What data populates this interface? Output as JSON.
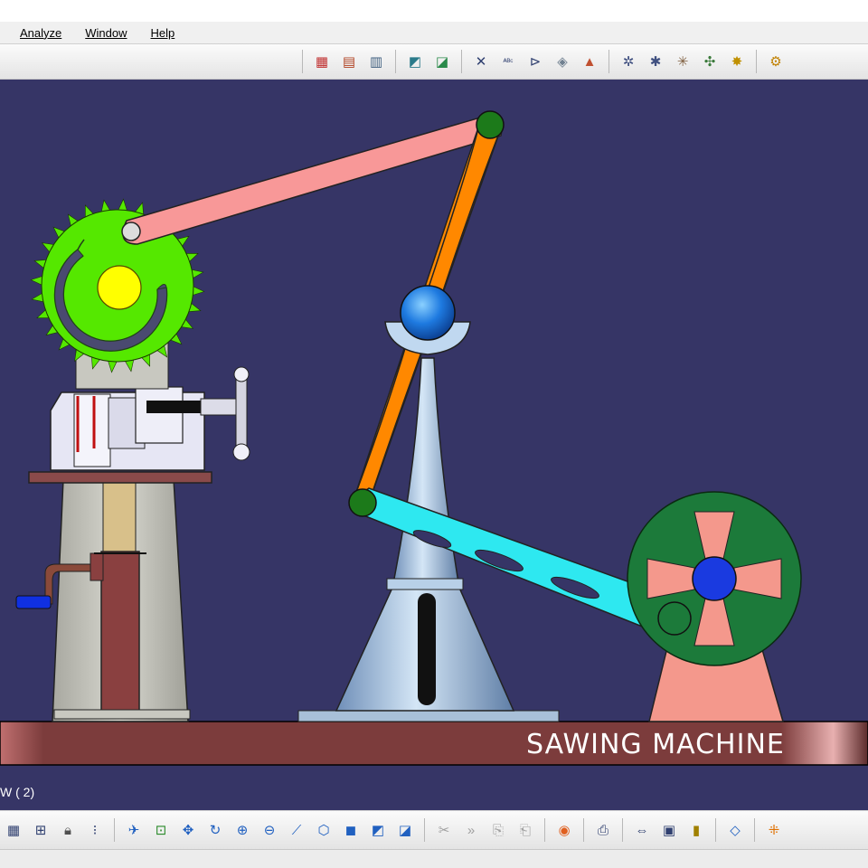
{
  "menu": {
    "items": [
      {
        "label": "Analyze"
      },
      {
        "label": "Window"
      },
      {
        "label": "Help"
      }
    ]
  },
  "toolbar_top": {
    "groups": [
      [
        "assembly-constraint-icon",
        "fix-component-icon",
        "manipulate-icon"
      ],
      [
        "snap-icon",
        "smart-move-icon"
      ],
      [
        "weld-symbol-icon",
        "text-annotation-icon",
        "flag-note-icon",
        "datum-target-icon",
        "roughness-icon"
      ],
      [
        "simulation-icon",
        "kinematics-icon",
        "compile-icon",
        "joint-icon",
        "mechanism-icon"
      ],
      [
        "settings-gear-icon"
      ]
    ]
  },
  "toolbar_bottom": {
    "groups": [
      [
        "grid-icon",
        "tree-icon",
        "lock-icon",
        "specification-icon"
      ],
      [
        "fly-mode-icon",
        "fit-all-icon",
        "pan-icon",
        "rotate-icon",
        "zoom-in-icon",
        "zoom-out-icon",
        "normal-view-icon",
        "iso-view-icon",
        "shading-icon",
        "hide-show-icon",
        "swap-visible-icon"
      ],
      [
        "cut-icon",
        "forward-icon",
        "copy-icon",
        "paste-icon"
      ],
      [
        "camera-icon"
      ],
      [
        "print-icon"
      ],
      [
        "measure-between-icon",
        "measure-item-icon",
        "measure-inertia-icon"
      ],
      [
        "sketch-plane-icon"
      ],
      [
        "compass-grid-icon"
      ]
    ]
  },
  "viewport": {
    "background": "#363566",
    "banner_text": "SAWING MACHINE",
    "status_text": "W ( 2)"
  },
  "colors": {
    "gear": "#55e800",
    "hub": "#ffff00",
    "connecting_rod": "#f89898",
    "rocker": "#ff8800",
    "pivot_ball": "#1e6fd9",
    "crank_link": "#2ee8f0",
    "flywheel": "#1c7a3a",
    "flywheel_support": "#f4988c",
    "base_plate": "#7a3c3c",
    "column": "#a8c8e8"
  }
}
